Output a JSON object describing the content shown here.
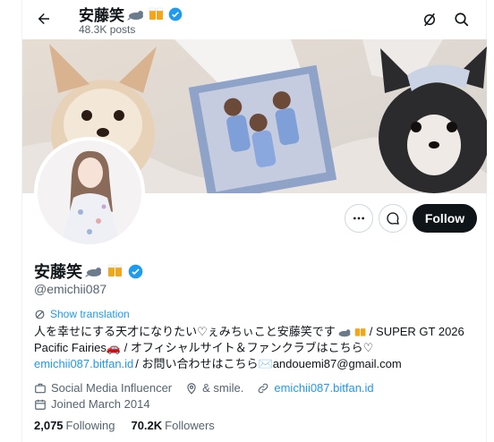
{
  "header": {
    "name": "安藤笑",
    "posts_count": "48.3K posts"
  },
  "profile": {
    "name": "安藤笑",
    "handle": "@emichii087",
    "follow_label": "Follow",
    "show_translation": "Show translation",
    "bio": {
      "line1_a": "人を幸せにする天才になりたい♡ぇみちぃこと安藤笑です",
      "line1_b": " / SUPER GT 2026",
      "line2": "Pacific Fairies🚗 / オフィシャルサイト＆ファンクラブはこちら♡",
      "line3_link": "emichii087.bitfan.id",
      "line3_text": " / お問い合わせはこちら✉️andouemi87@gmail.com"
    },
    "meta": {
      "category": "Social Media Influencer",
      "location": "& smile.",
      "website": "emichii087.bitfan.id",
      "joined": "Joined March 2014"
    },
    "stats": {
      "following_count": "2,075",
      "following_label": "Following",
      "followers_count": "70.2K",
      "followers_label": "Followers"
    }
  },
  "colors": {
    "verified": "#1d9bf0",
    "link": "#1d9bf0",
    "follow_bg": "#0f1419"
  },
  "icons": [
    "back-arrow-icon",
    "grok-icon",
    "search-icon",
    "more-icon",
    "message-icon",
    "translate-icon",
    "briefcase-icon",
    "location-icon",
    "link-icon",
    "calendar-icon",
    "verified-badge-icon",
    "seal-emoji",
    "beer-emoji"
  ]
}
